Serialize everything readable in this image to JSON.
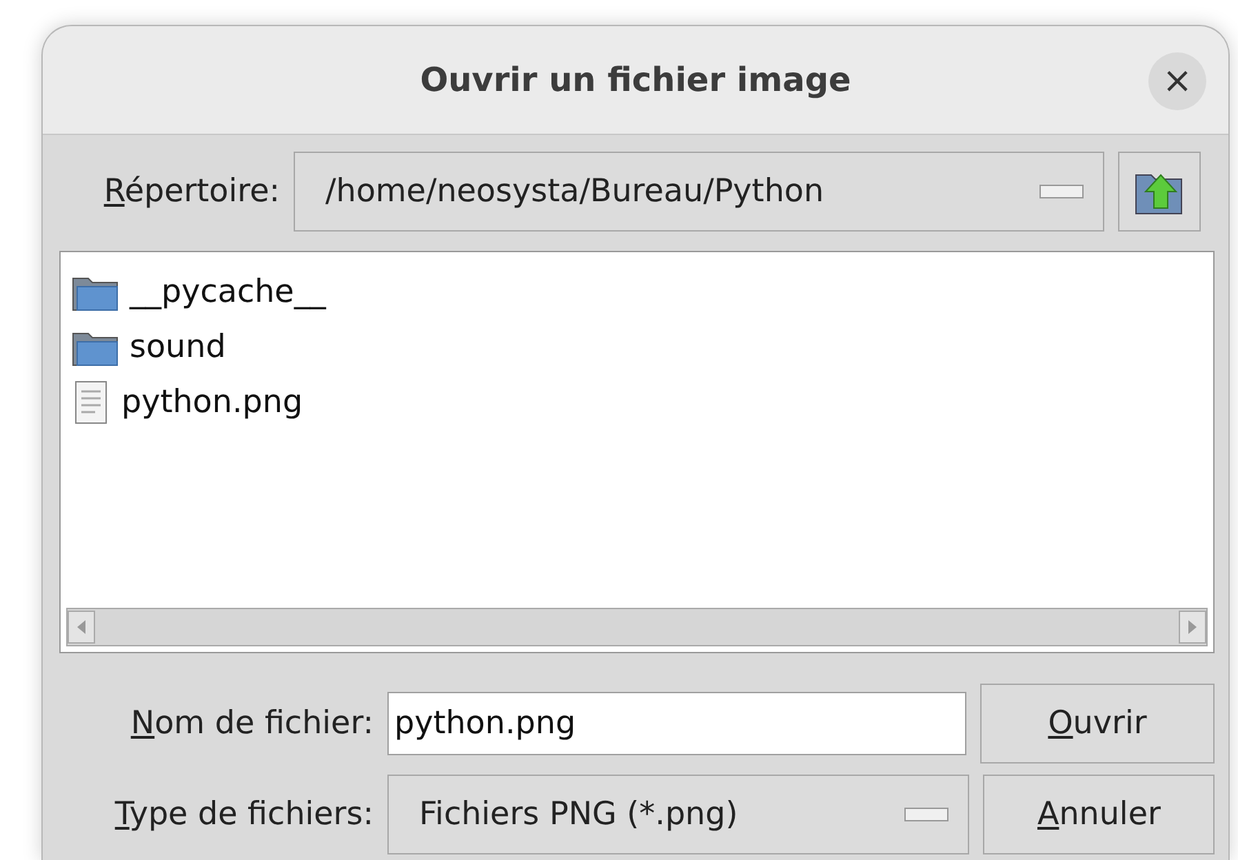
{
  "window": {
    "title": "Ouvrir un fichier image",
    "close": "×"
  },
  "directory": {
    "label_key": "R",
    "label_rest": "épertoire:",
    "value": "/home/neosysta/Bureau/Python"
  },
  "files": [
    {
      "kind": "folder",
      "name": "__pycache__"
    },
    {
      "kind": "folder",
      "name": "sound"
    },
    {
      "kind": "file",
      "name": "python.png"
    }
  ],
  "filename": {
    "label_key": "N",
    "label_rest": "om de fichier:",
    "value": "python.png"
  },
  "filetype": {
    "label_key": "T",
    "label_rest": "ype de fichiers:",
    "value": "Fichiers PNG (*.png)"
  },
  "buttons": [
    {
      "key": "O",
      "rest": "uvrir"
    },
    {
      "key": "A",
      "rest": "nnuler"
    }
  ]
}
